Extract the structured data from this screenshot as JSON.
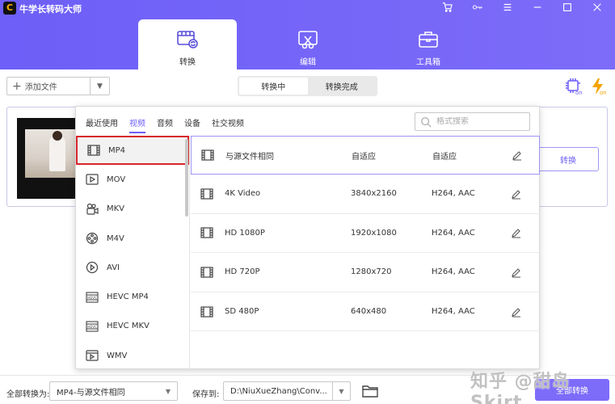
{
  "app": {
    "title": "牛学长转码大师",
    "logo_text": "C"
  },
  "main_tabs": [
    {
      "label": "转换",
      "active": true
    },
    {
      "label": "编辑",
      "active": false
    },
    {
      "label": "工具箱",
      "active": false
    }
  ],
  "toolbar": {
    "add_file_label": "添加文件",
    "segment": [
      {
        "label": "转换中",
        "active": true
      },
      {
        "label": "转换完成",
        "active": false
      }
    ]
  },
  "card": {
    "convert_label": "转换"
  },
  "popup": {
    "categories": [
      {
        "label": "最近使用",
        "active": false
      },
      {
        "label": "视频",
        "active": true
      },
      {
        "label": "音频",
        "active": false
      },
      {
        "label": "设备",
        "active": false
      },
      {
        "label": "社交视频",
        "active": false
      }
    ],
    "search_placeholder": "格式搜索",
    "formats": [
      {
        "label": "MP4",
        "icon": "film-icon",
        "selected": true
      },
      {
        "label": "MOV",
        "icon": "play-file-icon",
        "selected": false
      },
      {
        "label": "MKV",
        "icon": "camera-icon",
        "selected": false
      },
      {
        "label": "M4V",
        "icon": "reel-icon",
        "selected": false
      },
      {
        "label": "AVI",
        "icon": "play-circle-icon",
        "selected": false
      },
      {
        "label": "HEVC MP4",
        "icon": "hevc-icon",
        "selected": false
      },
      {
        "label": "HEVC MKV",
        "icon": "hevc-icon",
        "selected": false
      },
      {
        "label": "WMV",
        "icon": "play-file-icon",
        "selected": false
      }
    ],
    "presets": [
      {
        "name": "与源文件相同",
        "resolution": "自适应",
        "codec": "自适应",
        "selected": true
      },
      {
        "name": "4K Video",
        "resolution": "3840x2160",
        "codec": "H264, AAC",
        "selected": false
      },
      {
        "name": "HD 1080P",
        "resolution": "1920x1080",
        "codec": "H264, AAC",
        "selected": false
      },
      {
        "name": "HD 720P",
        "resolution": "1280x720",
        "codec": "H264, AAC",
        "selected": false
      },
      {
        "name": "SD 480P",
        "resolution": "640x480",
        "codec": "H264, AAC",
        "selected": false
      }
    ]
  },
  "bottom": {
    "convert_all_to_label": "全部转换为:",
    "convert_all_to_value": "MP4-与源文件相同",
    "save_to_label": "保存到:",
    "save_to_value": "D:\\NiuXueZhang\\Conv...",
    "convert_all_button": "全部转换"
  },
  "watermark": "知乎 @甜岛Skirt",
  "colors": {
    "accent": "#6d5ff7",
    "selected_border": "#d9262c"
  }
}
